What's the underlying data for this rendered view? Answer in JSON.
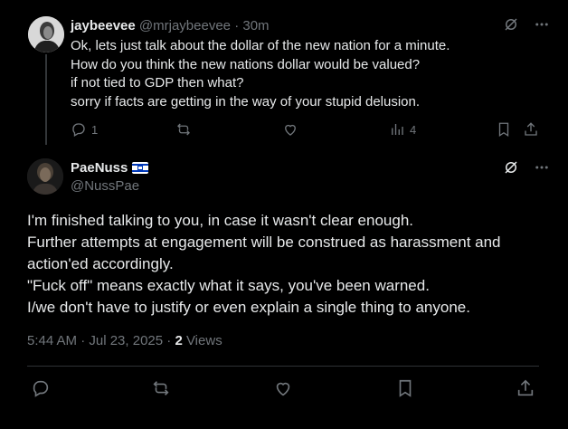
{
  "reply_tweet": {
    "display_name": "jaybeevee",
    "handle": "@mrjaybeevee",
    "separator": "·",
    "time": "30m",
    "lines": [
      "Ok, lets just talk about the dollar of the new nation for a minute.",
      "How do you think the new nations dollar would be valued?",
      "if not tied to GDP then what?",
      "sorry if facts are getting in the way of your stupid delusion."
    ],
    "reply_count": "1",
    "views_count": "4"
  },
  "main_tweet": {
    "display_name": "PaeNuss",
    "handle": "@NussPae",
    "lines": [
      "I'm finished talking to you, in case it wasn't clear enough.",
      "Further attempts at engagement will be construed as harassment and",
      "action'ed accordingly.",
      "\"Fuck off\" means exactly what it says, you've been warned.",
      "I/we don't have to justify or even explain a single thing to anyone."
    ],
    "timestamp": "5:44 AM · Jul 23, 2025 · ",
    "views_count": "2",
    "views_label": " Views"
  },
  "icons": {
    "grok": "grok-icon",
    "more": "more-icon",
    "reply": "reply-icon",
    "retweet": "retweet-icon",
    "like": "like-icon",
    "views": "views-icon",
    "bookmark": "bookmark-icon",
    "share": "share-icon"
  },
  "colors": {
    "background": "#000000",
    "text": "#e7e9ea",
    "secondary": "#71767b",
    "divider": "#2f3336"
  }
}
